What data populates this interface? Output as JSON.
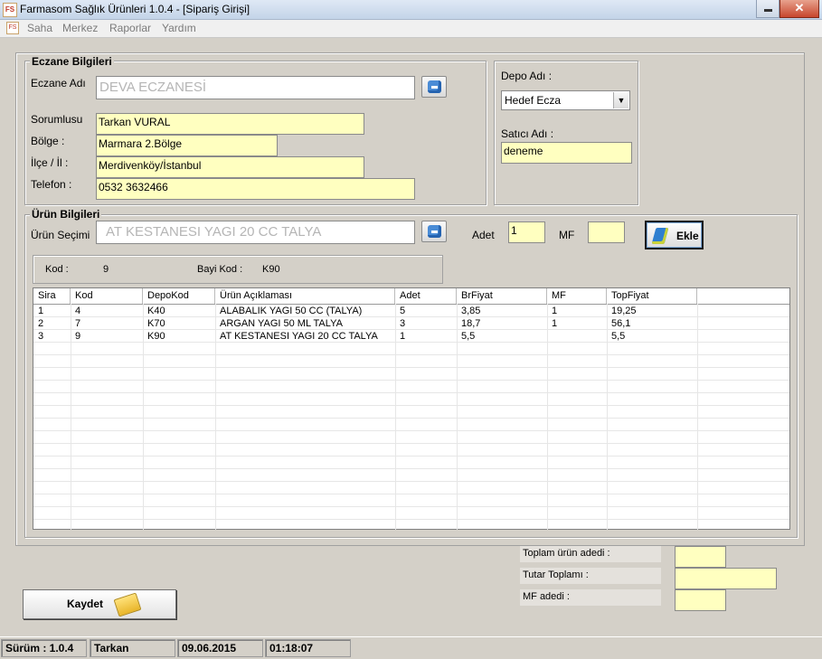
{
  "window": {
    "icon_text": "FS",
    "title": "Farmasom Sağlık Ürünleri   1.0.4 - [Sipariş Girişi]"
  },
  "menu": [
    "Saha",
    "Merkez",
    "Raporlar",
    "Yardım"
  ],
  "pharmacy": {
    "group_title": "Eczane Bilgileri",
    "name_label": "Eczane Adı",
    "name_value": "DEVA ECZANESİ",
    "responsible_label": "Sorumlusu",
    "responsible_value": "Tarkan VURAL",
    "region_label": "Bölge :",
    "region_value": "Marmara 2.Bölge",
    "district_label": "İlçe / İl :",
    "district_value": "Merdivenköy/İstanbul",
    "phone_label": "Telefon :",
    "phone_value": "0532 3632466"
  },
  "depot": {
    "depot_label": "Depo Adı :",
    "depot_value": "Hedef Ecza",
    "seller_label": "Satıcı Adı :",
    "seller_value": "deneme"
  },
  "product": {
    "group_title": "Ürün Bilgileri",
    "select_label": "Ürün Seçimi",
    "select_value": "AT KESTANESI YAGI 20 CC TALYA",
    "qty_label": "Adet",
    "qty_value": "1",
    "mf_label": "MF",
    "mf_value": "",
    "add_button": "Ekle",
    "code_label": "Kod :",
    "code_value": "9",
    "dealer_code_label": "Bayi Kod :",
    "dealer_code_value": "K90"
  },
  "grid": {
    "columns": [
      "Sira",
      "Kod",
      "DepoKod",
      "Ürün Açıklaması",
      "Adet",
      "BrFiyat",
      "MF",
      "TopFiyat"
    ],
    "rows": [
      [
        "1",
        "4",
        "K40",
        "ALABALIK YAGI 50 CC (TALYA)",
        "5",
        "3,85",
        "1",
        "19,25"
      ],
      [
        "2",
        "7",
        "K70",
        "ARGAN YAGI 50 ML TALYA",
        "3",
        "18,7",
        "1",
        "56,1"
      ],
      [
        "3",
        "9",
        "K90",
        "AT KESTANESI YAGI 20 CC TALYA",
        "1",
        "5,5",
        "",
        "5,5"
      ]
    ]
  },
  "totals": {
    "total_items_label": "Toplam ürün adedi :",
    "total_items_value": "",
    "total_amount_label": "Tutar Toplamı :",
    "total_amount_value": "",
    "mf_count_label": "MF adedi :",
    "mf_count_value": ""
  },
  "save_button": "Kaydet",
  "status": {
    "version": "Sürüm : 1.0.4",
    "user": "Tarkan",
    "date": "09.06.2015",
    "time": "01:18:07"
  },
  "colors": {
    "field_yellow": "#ffffc0",
    "background": "#d4d0c8"
  }
}
